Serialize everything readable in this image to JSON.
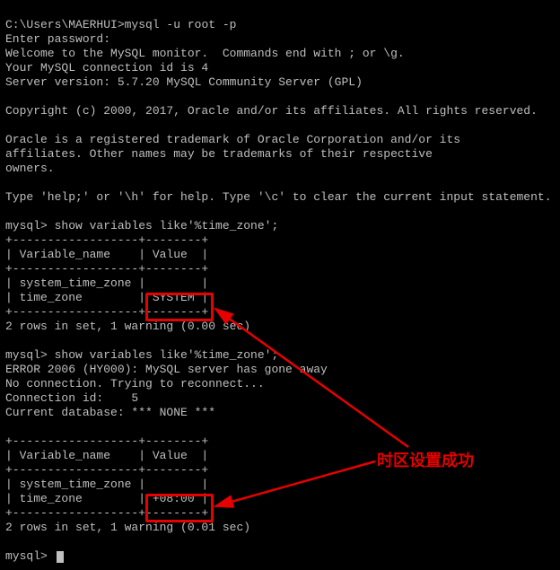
{
  "prompt_path": "C:\\Users\\MAERHUI>",
  "cmd_mysql_login": "mysql -u root -p",
  "enter_password": "Enter password:",
  "welcome": "Welcome to the MySQL monitor.  Commands end with ; or \\g.",
  "conn_id": "Your MySQL connection id is 4",
  "server_ver": "Server version: 5.7.20 MySQL Community Server (GPL)",
  "copyright": "Copyright (c) 2000, 2017, Oracle and/or its affiliates. All rights reserved.",
  "trademark1": "Oracle is a registered trademark of Oracle Corporation and/or its",
  "trademark2": "affiliates. Other names may be trademarks of their respective",
  "trademark3": "owners.",
  "help": "Type 'help;' or '\\h' for help. Type '\\c' to clear the current input statement.",
  "mysql_prompt": "mysql>",
  "query": "show variables like'%time_zone';",
  "tbl_border": "+------------------+--------+",
  "tbl_header": "| Variable_name    | Value  |",
  "tbl_r1a": "| system_time_zone |        |",
  "tbl_r1b": "| time_zone        | SYSTEM |",
  "tbl_r2a": "| system_time_zone |        |",
  "tbl_r2b": "| time_zone        | +08:00 |",
  "result1": "2 rows in set, 1 warning (0.00 sec)",
  "result2": "2 rows in set, 1 warning (0.01 sec)",
  "err2006": "ERROR 2006 (HY000): MySQL server has gone away",
  "noconn": "No connection. Trying to reconnect...",
  "connid2": "Connection id:    5",
  "curdb": "Current database: *** NONE ***",
  "annotation": "时区设置成功",
  "hl1_value": "SYSTEM",
  "hl2_value": "+08:00"
}
